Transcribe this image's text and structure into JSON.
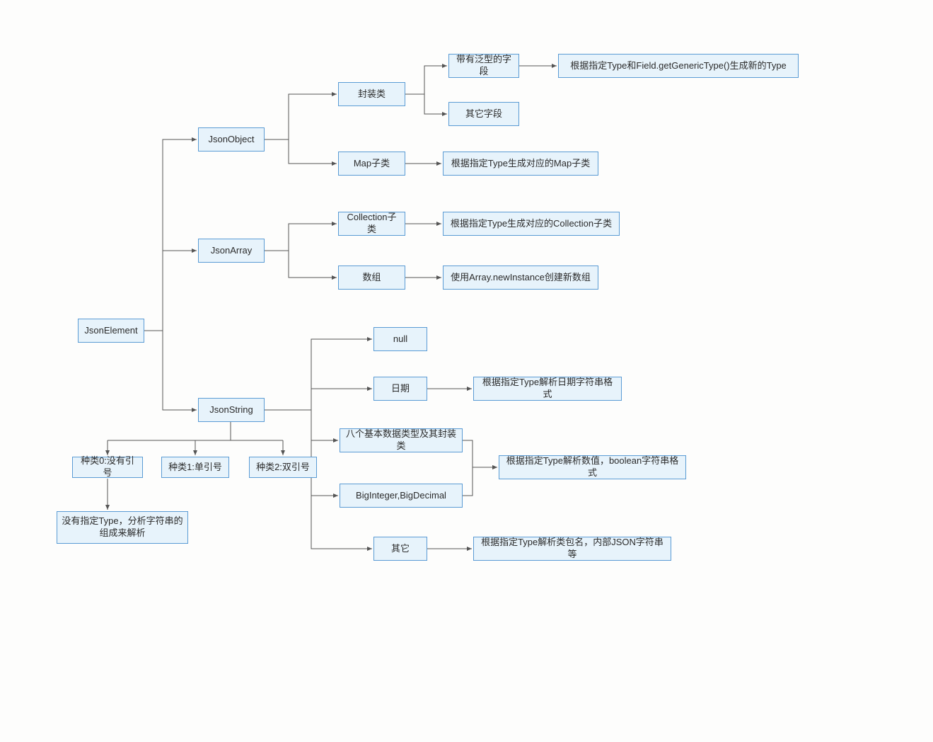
{
  "nodes": {
    "jsonElement": "JsonElement",
    "jsonObject": "JsonObject",
    "jsonArray": "JsonArray",
    "jsonString": "JsonString",
    "wrapper": "封装类",
    "mapSubclass": "Map子类",
    "genericField": "带有泛型的字段",
    "otherField": "其它字段",
    "genericTypeResult": "根据指定Type和Field.getGenericType()生成新的Type",
    "mapResult": "根据指定Type生成对应的Map子类",
    "collectionSubclass": "Collection子类",
    "arrayNode": "数组",
    "collectionResult": "根据指定Type生成对应的Collection子类",
    "arrayResult": "使用Array.newInstance创建新数组",
    "nullNode": "null",
    "dateNode": "日期",
    "primitivesNode": "八个基本数据类型及其封装类",
    "bigNumNode": "BigInteger,BigDecimal",
    "otherTypeNode": "其它",
    "dateResult": "根据指定Type解析日期字符串格式",
    "numBoolResult": "根据指定Type解析数值，boolean字符串格式",
    "otherResult": "根据指定Type解析类包名，内部JSON字符串等",
    "kind0": "种类0:没有引号",
    "kind1": "种类1:单引号",
    "kind2": "种类2:双引号",
    "kind0Result": "没有指定Type，分析字符串的组成来解析"
  }
}
